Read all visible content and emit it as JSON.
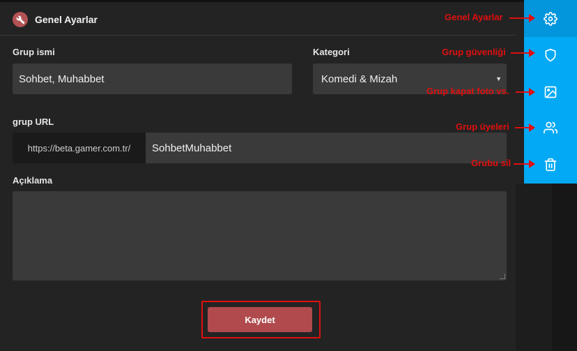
{
  "header": {
    "title": "Genel Ayarlar",
    "icon": "wrench-icon"
  },
  "form": {
    "group_name": {
      "label": "Grup ismi",
      "value": "Sohbet, Muhabbet"
    },
    "category": {
      "label": "Kategori",
      "selected": "Komedi & Mizah"
    },
    "group_url": {
      "label": "grup URL",
      "prefix": "https://beta.gamer.com.tr/",
      "value": "SohbetMuhabbet"
    },
    "description": {
      "label": "Açıklama",
      "value": ""
    },
    "save_label": "Kaydet"
  },
  "sidebar": {
    "items": [
      {
        "icon": "gear-icon",
        "annotation": "Genel Ayarlar",
        "active": true
      },
      {
        "icon": "shield-icon",
        "annotation": "Grup güvenliği"
      },
      {
        "icon": "image-icon",
        "annotation": "Grup kapat foto vs."
      },
      {
        "icon": "users-icon",
        "annotation": "Grup üyeleri"
      },
      {
        "icon": "trash-icon",
        "annotation": "Grubu sil"
      }
    ]
  },
  "colors": {
    "accent": "#03a9f4",
    "save_button": "#b04a4d",
    "annotation": "#e10f0f",
    "panel": "#232323"
  }
}
